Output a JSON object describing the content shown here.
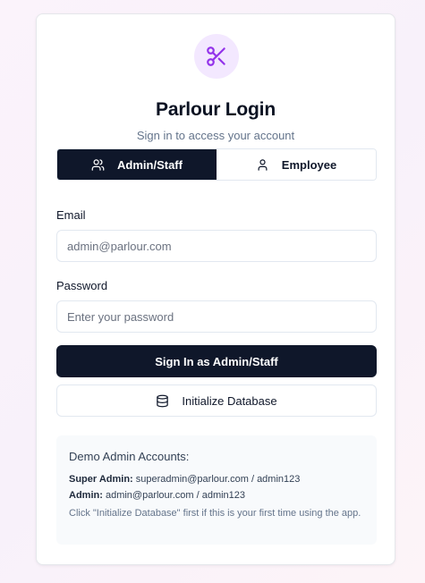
{
  "app": {
    "title": "Parlour Login",
    "subtitle": "Sign in to access your account"
  },
  "tabs": [
    {
      "label": "Admin/Staff",
      "active": true,
      "icon": "users-icon"
    },
    {
      "label": "Employee",
      "active": false,
      "icon": "user-icon"
    }
  ],
  "form": {
    "email_label": "Email",
    "email_placeholder": "admin@parlour.com",
    "email_value": "",
    "password_label": "Password",
    "password_placeholder": "Enter your password",
    "password_value": "",
    "submit_label": "Sign In as Admin/Staff",
    "init_db_label": "Initialize Database",
    "init_db_icon": "database-icon"
  },
  "demo": {
    "title": "Demo Admin Accounts:",
    "accounts": [
      {
        "role": "Super Admin:",
        "credentials": "superadmin@parlour.com / admin123"
      },
      {
        "role": "Admin:",
        "credentials": "admin@parlour.com / admin123"
      }
    ],
    "note": "Click \"Initialize Database\" first if this is your first time using the app."
  },
  "colors": {
    "primary": "#0f172a",
    "accent": "#9333ea",
    "accent_bg": "#f3e8ff",
    "muted": "#64748b"
  },
  "logo_icon": "scissors-icon"
}
